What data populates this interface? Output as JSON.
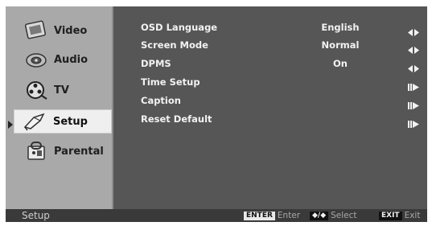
{
  "sidebar": {
    "items": [
      {
        "label": "Video",
        "icon": "video-icon",
        "selected": false
      },
      {
        "label": "Audio",
        "icon": "audio-icon",
        "selected": false
      },
      {
        "label": "TV",
        "icon": "tv-reel-icon",
        "selected": false
      },
      {
        "label": "Setup",
        "icon": "setup-icon",
        "selected": true
      },
      {
        "label": "Parental",
        "icon": "parental-icon",
        "selected": false
      }
    ]
  },
  "settings": [
    {
      "name": "OSD Language",
      "value": "English",
      "control": "left-right-arrows-icon"
    },
    {
      "name": "Screen Mode",
      "value": "Normal",
      "control": "left-right-arrows-icon"
    },
    {
      "name": "DPMS",
      "value": "On",
      "control": "left-right-arrows-icon"
    },
    {
      "name": "Time Setup",
      "value": "",
      "control": "enter-submenu-icon"
    },
    {
      "name": "Caption",
      "value": "",
      "control": "enter-submenu-icon"
    },
    {
      "name": "Reset Default",
      "value": "",
      "control": "enter-submenu-icon"
    }
  ],
  "footer": {
    "title": "Setup",
    "hints": [
      {
        "key": "ENTER",
        "text": "Enter"
      },
      {
        "key": "◆/◆",
        "text": "Select"
      },
      {
        "key": "EXIT",
        "text": "Exit"
      }
    ]
  },
  "colors": {
    "sidebar_bg": "#a9a9a9",
    "main_bg": "#565656",
    "selected_bg": "#efefef",
    "text": "#f2f2f2"
  }
}
